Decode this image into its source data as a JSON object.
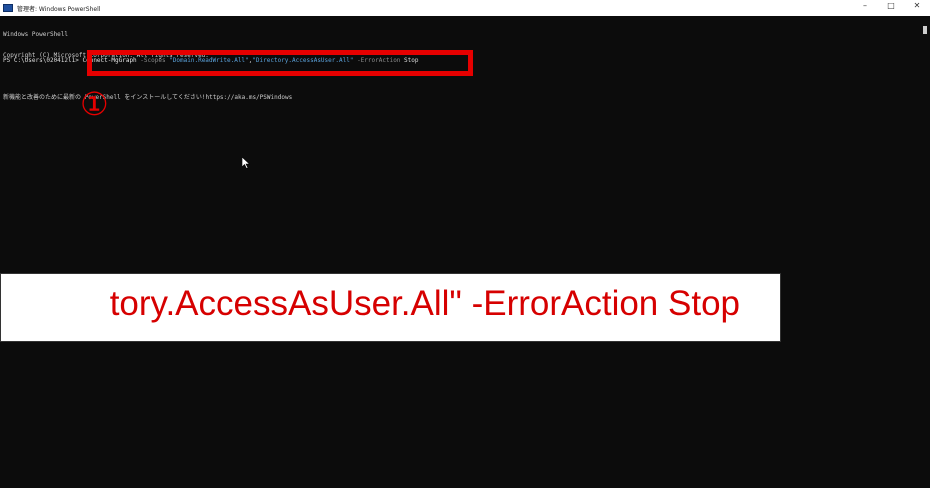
{
  "window": {
    "title": "管理者: Windows PowerShell",
    "controls": {
      "minimize": "–",
      "maximize": "□",
      "close": "✕"
    }
  },
  "console": {
    "lines": [
      "Windows PowerShell",
      "Copyright (C) Microsoft Corporation. All rights reserved.",
      "",
      "新機能と改善のために最新の PowerShell をインストールしてください!https://aka.ms/PSWindows",
      ""
    ],
    "prompt": "PS C:\\Users\\020412l1> ",
    "command": {
      "cmdlet": "Connect-MgGraph",
      "param1": " -Scopes ",
      "scope1": "\"Domain.ReadWrite.All\"",
      "comma": ",",
      "scope2": "\"Directory.AccessAsUser.All\"",
      "param2": " -ErrorAction ",
      "value": "Stop"
    }
  },
  "annotation": {
    "step_number": "①",
    "zoom_text": "tory.AccessAsUser.All\" -ErrorAction Stop",
    "highlight_color": "#e60000"
  }
}
